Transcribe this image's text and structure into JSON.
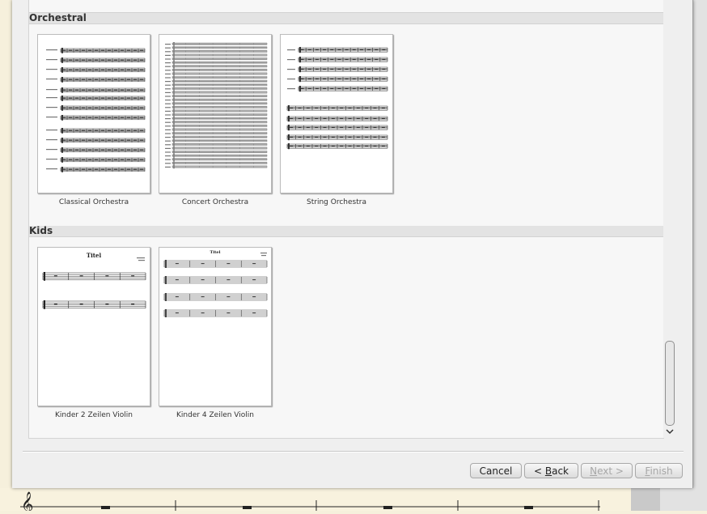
{
  "sections": [
    {
      "title": "Orchestral",
      "templates": [
        {
          "label": "Classical Orchestra",
          "icon": "classical-orchestra-score-thumbnail"
        },
        {
          "label": "Concert Orchestra",
          "icon": "concert-orchestra-score-thumbnail"
        },
        {
          "label": "String Orchestra",
          "icon": "string-orchestra-score-thumbnail"
        }
      ]
    },
    {
      "title": "Kids",
      "templates": [
        {
          "label": "Kinder 2 Zeilen Violin",
          "icon": "kinder-2-zeilen-score-thumbnail",
          "preview_title": "Titel"
        },
        {
          "label": "Kinder 4 Zeilen Violin",
          "icon": "kinder-4-zeilen-score-thumbnail",
          "preview_title": "Titel"
        }
      ]
    }
  ],
  "buttons": {
    "cancel": "Cancel",
    "back": {
      "pre": "< ",
      "mnemonic": "B",
      "post": "ack"
    },
    "next": {
      "mnemonic": "N",
      "post": "ext >"
    },
    "finish": {
      "mnemonic": "F",
      "post": "inish"
    }
  },
  "colors": {
    "dialog_bg": "#efefef",
    "panel_bg": "#f7f7f7",
    "section_header_bg": "#e3e3e3",
    "disabled_text": "#a7a7a7"
  }
}
